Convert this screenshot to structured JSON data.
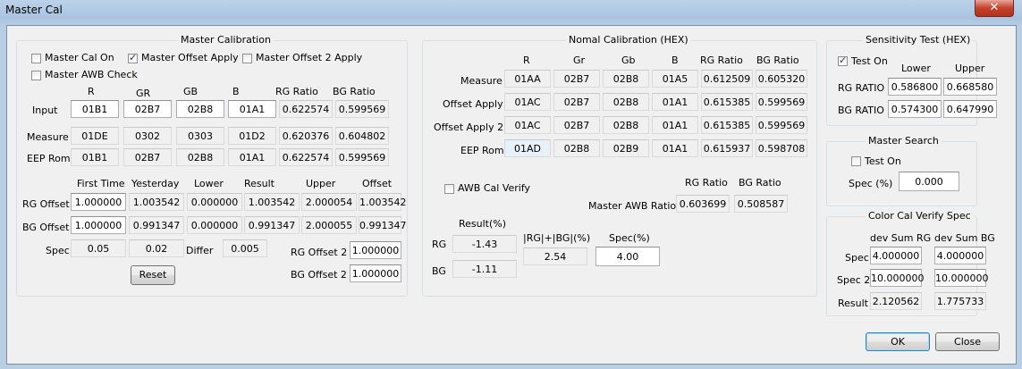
{
  "window": {
    "title": "Master Cal",
    "close_glyph": "✕"
  },
  "master_calibration": {
    "title": "Master Calibration",
    "checkboxes": [
      {
        "label": "Master Cal On",
        "checked": false
      },
      {
        "label": "Master Offset Apply",
        "checked": true
      },
      {
        "label": "Master Offset 2 Apply",
        "checked": false
      },
      {
        "label": "Master AWB Check",
        "checked": false
      }
    ],
    "columns": [
      "R",
      "GR",
      "GB",
      "B",
      "RG Ratio",
      "BG Ratio"
    ],
    "rows": [
      {
        "label": "Input",
        "values": [
          "01B1",
          "02B7",
          "02B8",
          "01A1",
          "0.622574",
          "0.599569"
        ]
      },
      {
        "label": "Measure",
        "values": [
          "01DE",
          "0302",
          "0303",
          "01D2",
          "0.620376",
          "0.604802"
        ]
      },
      {
        "label": "EEP Rom",
        "values": [
          "01B1",
          "02B7",
          "02B8",
          "01A1",
          "0.622574",
          "0.599569"
        ]
      }
    ],
    "offset_columns": [
      "First Time",
      "Yesterday",
      "Lower",
      "Result",
      "Upper",
      "Offset"
    ],
    "offset_rows": [
      {
        "label": "RG Offset",
        "values": [
          "1.000000",
          "1.003542",
          "0.000000",
          "1.003542",
          "2.000054",
          "1.003542"
        ]
      },
      {
        "label": "BG Offset",
        "values": [
          "1.000000",
          "0.991347",
          "0.000000",
          "0.991347",
          "2.000055",
          "0.991347"
        ]
      }
    ],
    "spec": {
      "label": "Spec",
      "v1": "0.05",
      "v2": "0.02",
      "differ_label": "Differ",
      "differ": "0.005"
    },
    "rg_offset2": {
      "label": "RG Offset 2",
      "value": "1.000000"
    },
    "bg_offset2": {
      "label": "BG Offset 2",
      "value": "1.000000"
    },
    "reset_label": "Reset"
  },
  "nomal_calibration": {
    "title": "Nomal Calibration (HEX)",
    "columns": [
      "R",
      "Gr",
      "Gb",
      "B",
      "RG Ratio",
      "BG Ratio"
    ],
    "rows": [
      {
        "label": "Measure",
        "values": [
          "01AA",
          "02B7",
          "02B8",
          "01A5",
          "0.612509",
          "0.605320"
        ]
      },
      {
        "label": "Offset Apply",
        "values": [
          "01AC",
          "02B7",
          "02B8",
          "01A1",
          "0.615385",
          "0.599569"
        ]
      },
      {
        "label": "Offset Apply 2",
        "values": [
          "01AC",
          "02B7",
          "02B8",
          "01A1",
          "0.615385",
          "0.599569"
        ]
      },
      {
        "label": "EEP Rom",
        "values": [
          "01AD",
          "02B8",
          "02B9",
          "01A1",
          "0.615937",
          "0.598708"
        ]
      }
    ],
    "awb_verify": {
      "label": "AWB Cal Verify",
      "checked": false
    },
    "awb_ratio": {
      "label": "Master AWB Ratio",
      "rg_header": "RG Ratio",
      "bg_header": "BG Ratio",
      "rg": "0.603699",
      "bg": "0.508587"
    },
    "result": {
      "header": "Result(%)",
      "rg_label": "RG",
      "bg_label": "BG",
      "rg": "-1.43",
      "bg": "-1.11"
    },
    "sum": {
      "header": "|RG|+|BG|(%)",
      "value": "2.54"
    },
    "spec": {
      "header": "Spec(%)",
      "value": "4.00"
    }
  },
  "sensitivity_test": {
    "title": "Sensitivity Test (HEX)",
    "test_on": {
      "label": "Test On",
      "checked": true
    },
    "lower_header": "Lower",
    "upper_header": "Upper",
    "rows": [
      {
        "label": "RG RATIO",
        "lower": "0.586800",
        "upper": "0.668580"
      },
      {
        "label": "BG RATIO",
        "lower": "0.574300",
        "upper": "0.647990"
      }
    ]
  },
  "master_search": {
    "title": "Master Search",
    "test_on": {
      "label": "Test On",
      "checked": false
    },
    "spec_label": "Spec (%)",
    "spec_value": "0.000"
  },
  "color_cal_verify": {
    "title": "Color Cal Verify Spec",
    "headers": [
      "dev Sum RG",
      "dev Sum BG"
    ],
    "rows": [
      {
        "label": "Spec",
        "rg": "4.000000",
        "bg": "4.000000"
      },
      {
        "label": "Spec 2",
        "rg": "10.000000",
        "bg": "10.000000"
      },
      {
        "label": "Result",
        "rg": "2.120562",
        "bg": "1.775733"
      }
    ]
  },
  "buttons": {
    "ok": "OK",
    "close": "Close"
  }
}
